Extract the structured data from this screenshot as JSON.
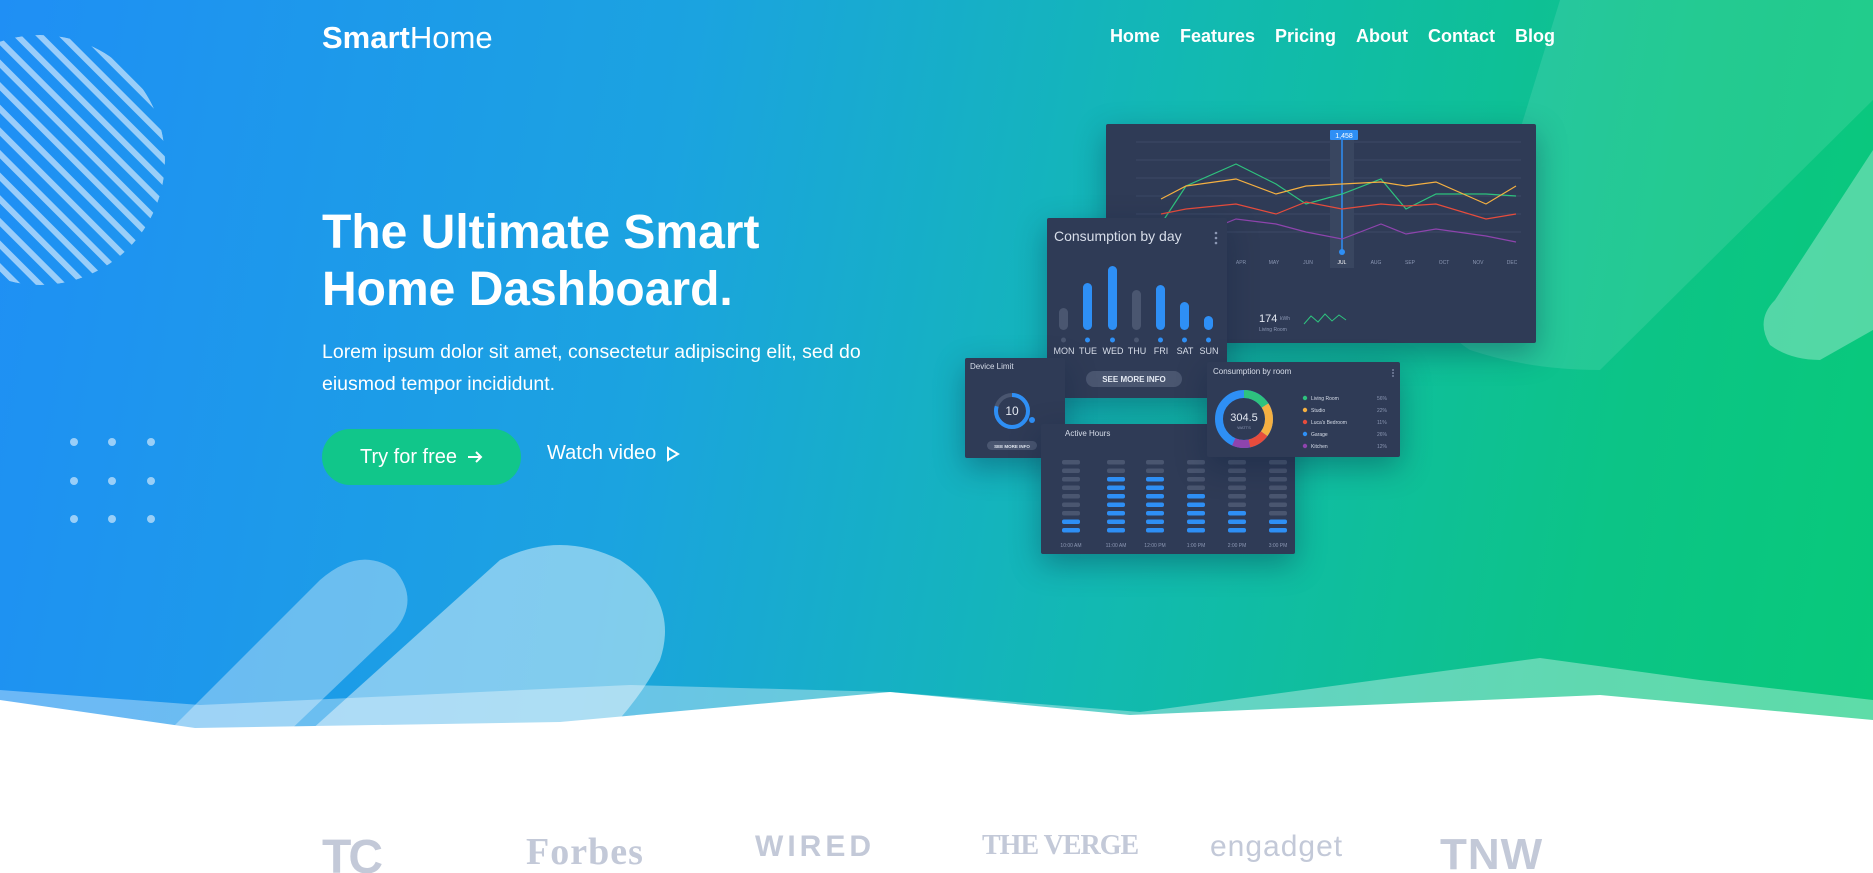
{
  "brand": {
    "logo_bold": "Smart",
    "logo_light": "Home"
  },
  "nav": {
    "items": [
      "Home",
      "Features",
      "Pricing",
      "About",
      "Contact",
      "Blog"
    ]
  },
  "hero": {
    "headline_line1": "The Ultimate Smart",
    "headline_line2": "Home Dashboard.",
    "subtext_line1": "Lorem ipsum dolor sit amet, consectetur adipiscing elit, sed do",
    "subtext_line2": "eiusmod tempor incididunt.",
    "cta_primary": "Try for free",
    "cta_secondary": "Watch video"
  },
  "dashboard": {
    "line_chart": {
      "marker": "1,458",
      "months": [
        "APR",
        "MAY",
        "JUN",
        "JUL",
        "AUG",
        "SEP",
        "OCT",
        "NOV",
        "DEC"
      ],
      "highlight": "JUL",
      "stat_value": "174",
      "stat_unit": "kWh",
      "stat_label": "Living Room"
    },
    "consumption_by_day": {
      "title": "Consumption by day",
      "days": [
        "MON",
        "TUE",
        "WED",
        "THU",
        "FRI",
        "SAT",
        "SUN"
      ],
      "button": "SEE MORE INFO"
    },
    "device_limit": {
      "title": "Device Limit",
      "value": "10",
      "button": "SEE MORE INFO"
    },
    "consumption_by_room": {
      "title": "Consumption by room",
      "total": "304.5",
      "unit": "WATTS",
      "rooms": [
        {
          "name": "Living Room",
          "pct": "56%",
          "color": "#2ec27e"
        },
        {
          "name": "Studio",
          "pct": "22%",
          "color": "#f5b041"
        },
        {
          "name": "Luca's Bedroom",
          "pct": "11%",
          "color": "#e74c3c"
        },
        {
          "name": "Garage",
          "pct": "26%",
          "color": "#2e8ff5"
        },
        {
          "name": "Kitchen",
          "pct": "12%",
          "color": "#8e44ad"
        }
      ]
    },
    "active_hours": {
      "title": "Active Hours",
      "times": [
        "10:00 AM",
        "11:00 AM",
        "12:00 PM",
        "1:00 PM",
        "2:00 PM",
        "3:00 PM"
      ]
    }
  },
  "press_logos": [
    "TC",
    "Forbes",
    "WIRED",
    "THE VERGE",
    "engadget",
    "TNW"
  ],
  "colors": {
    "accent_green": "#11c68a",
    "gradient_start": "#1f8ff5",
    "gradient_end": "#08c97a",
    "card_bg": "#2f3b56"
  }
}
